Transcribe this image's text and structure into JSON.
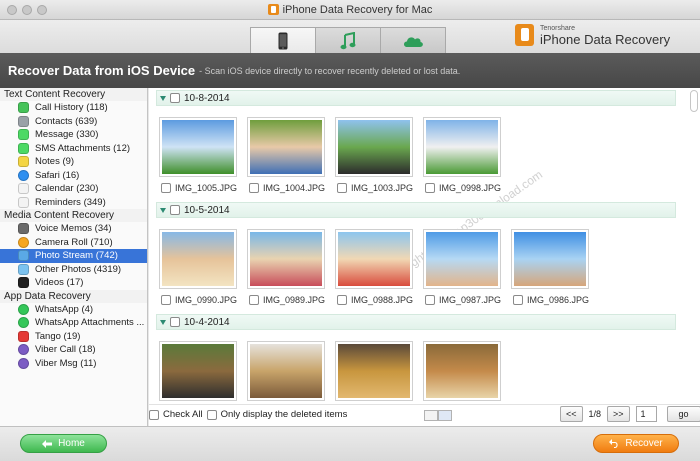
{
  "window": {
    "title": "iPhone Data Recovery for Mac"
  },
  "tabs": [
    {
      "name": "device",
      "icon": "phone-icon"
    },
    {
      "name": "itunes",
      "icon": "music-icon"
    },
    {
      "name": "icloud",
      "icon": "cloud-icon"
    }
  ],
  "brand": {
    "company": "Tenorshare",
    "product": "iPhone Data Recovery"
  },
  "infobar": {
    "title": "Recover Data from iOS Device",
    "subtitle": "- Scan iOS device directly to recover recently deleted or lost data."
  },
  "sidebar": {
    "sections": [
      {
        "title": "Text Content Recovery",
        "items": [
          {
            "label": "Call History (118)",
            "icon": "phone-call-icon",
            "color": "#46c35a"
          },
          {
            "label": "Contacts (639)",
            "icon": "contacts-icon",
            "color": "#9aa1a8"
          },
          {
            "label": "Message (330)",
            "icon": "message-icon",
            "color": "#4cd964"
          },
          {
            "label": "SMS Attachments (12)",
            "icon": "sms-attachment-icon",
            "color": "#4cd964"
          },
          {
            "label": "Notes (9)",
            "icon": "notes-icon",
            "color": "#f4d542"
          },
          {
            "label": "Safari (16)",
            "icon": "safari-icon",
            "color": "#2e8ff0"
          },
          {
            "label": "Calendar (230)",
            "icon": "calendar-icon",
            "color": "#f3f3f3"
          },
          {
            "label": "Reminders (349)",
            "icon": "reminders-icon",
            "color": "#f3f3f3"
          }
        ]
      },
      {
        "title": "Media Content Recovery",
        "items": [
          {
            "label": "Voice Memos (34)",
            "icon": "voice-memo-icon",
            "color": "#6a6a6a"
          },
          {
            "label": "Camera Roll (710)",
            "icon": "camera-roll-icon",
            "color": "#f5a623"
          },
          {
            "label": "Photo Stream (742)",
            "icon": "photo-stream-icon",
            "color": "#5aa9e6",
            "selected": true
          },
          {
            "label": "Other Photos (4319)",
            "icon": "other-photos-icon",
            "color": "#7cc3f0"
          },
          {
            "label": "Videos (17)",
            "icon": "videos-icon",
            "color": "#222222"
          }
        ]
      },
      {
        "title": "App Data Recovery",
        "items": [
          {
            "label": "WhatsApp (4)",
            "icon": "whatsapp-icon",
            "color": "#34c759"
          },
          {
            "label": "WhatsApp Attachments ...",
            "icon": "whatsapp-attachments-icon",
            "color": "#34c759"
          },
          {
            "label": "Tango (19)",
            "icon": "tango-icon",
            "color": "#e53935"
          },
          {
            "label": "Viber Call (18)",
            "icon": "viber-call-icon",
            "color": "#7c5cc4"
          },
          {
            "label": "Viber Msg (11)",
            "icon": "viber-msg-icon",
            "color": "#7c5cc4"
          }
        ]
      }
    ]
  },
  "groups": [
    {
      "date": "10-8-2014",
      "photos": [
        {
          "name": "IMG_1005.JPG",
          "colors": [
            "#5c9be0",
            "#cfe3f5",
            "#3f8f2a"
          ]
        },
        {
          "name": "IMG_1004.JPG",
          "colors": [
            "#6f9e3d",
            "#e8c9a8",
            "#3f6fb5"
          ]
        },
        {
          "name": "IMG_1003.JPG",
          "colors": [
            "#8fc2ee",
            "#6aa84f",
            "#2c2c2c"
          ]
        },
        {
          "name": "IMG_0998.JPG",
          "colors": [
            "#7fb3e8",
            "#f0f0f0",
            "#4a9a35"
          ]
        }
      ]
    },
    {
      "date": "10-5-2014",
      "photos": [
        {
          "name": "IMG_0990.JPG",
          "colors": [
            "#87b8e6",
            "#e6c39a",
            "#f3e4c2"
          ]
        },
        {
          "name": "IMG_0989.JPG",
          "colors": [
            "#79b7e8",
            "#e9d3b0",
            "#c84d5a"
          ]
        },
        {
          "name": "IMG_0988.JPG",
          "colors": [
            "#8cc5ee",
            "#f1d8b4",
            "#d94c3d"
          ]
        },
        {
          "name": "IMG_0987.JPG",
          "colors": [
            "#4e9be6",
            "#b6d9f4",
            "#e2b48a"
          ]
        },
        {
          "name": "IMG_0986.JPG",
          "colors": [
            "#3f8fe3",
            "#a9d3f3",
            "#d6a67b"
          ]
        }
      ]
    },
    {
      "date": "10-4-2014",
      "photos": [
        {
          "name": "",
          "colors": [
            "#5a7a3a",
            "#8b6a3e",
            "#2e2e2e"
          ]
        },
        {
          "name": "",
          "colors": [
            "#e6e2dc",
            "#c8a46a",
            "#7b5a3a"
          ]
        },
        {
          "name": "",
          "colors": [
            "#5b4a3a",
            "#c8963e",
            "#e2b870"
          ]
        },
        {
          "name": "",
          "colors": [
            "#8a6a3a",
            "#c48a4a",
            "#e8d4a8"
          ]
        }
      ]
    }
  ],
  "watermark": "Copyright © www.p30download.com",
  "bottom": {
    "check_all": "Check All",
    "only_deleted": "Only display the deleted items",
    "prev": "<<",
    "page": "1/8",
    "next": ">>",
    "page_input": "1",
    "go": "go"
  },
  "footer": {
    "home": "Home",
    "recover": "Recover"
  }
}
